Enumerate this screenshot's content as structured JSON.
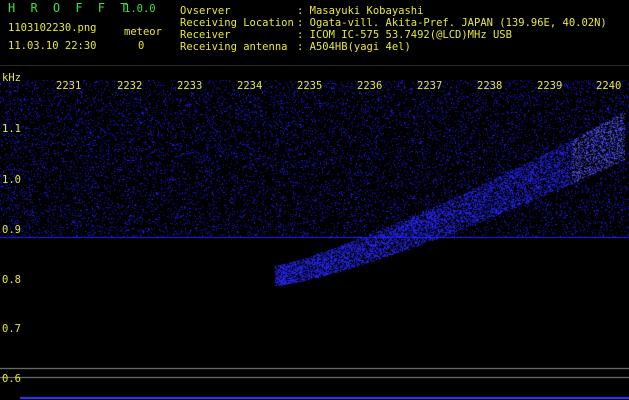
{
  "header": {
    "app_title": "H R O F F T",
    "version": "1.0.0",
    "filename": "1103102230.png",
    "datetime": "11.03.10 22:30",
    "meteor_label": "meteor",
    "meteor_count": "0",
    "info": [
      {
        "label": "Ovserver",
        "value": ": Masayuki Kobayashi"
      },
      {
        "label": "Receiving Location",
        "value": ": Ogata-vill. Akita-Pref. JAPAN (139.96E, 40.02N)"
      },
      {
        "label": "Receiver",
        "value": ": ICOM IC-575 53.7492(@LCD)MHz USB"
      },
      {
        "label": "Receiving antenna",
        "value": ": A504HB(yagi 4el)"
      }
    ]
  },
  "axes": {
    "y_unit": "kHz",
    "x_ticks": [
      "2231",
      "2232",
      "2233",
      "2234",
      "2235",
      "2236",
      "2237",
      "2238",
      "2239",
      "2240"
    ],
    "y_ticks": [
      "1.1",
      "1.0",
      "0.9",
      "0.8",
      "0.7",
      "0.6"
    ]
  },
  "colors": {
    "background": "#000000",
    "header_green": "#3ce03c",
    "label_yellow": "#e8e838",
    "noise_blue": "#1a1aff",
    "baseline_line": "#2020ff",
    "grey_line": "#8a8a8a"
  }
}
